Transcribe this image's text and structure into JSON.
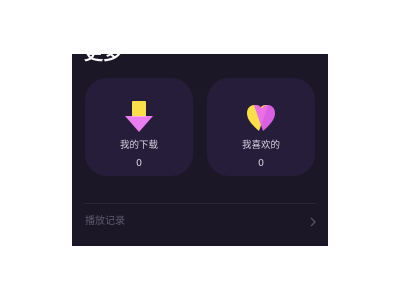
{
  "section": {
    "title": "更多"
  },
  "cards": [
    {
      "label": "我的下载",
      "count": "0",
      "icon": "download-arrow-icon"
    },
    {
      "label": "我喜欢的",
      "count": "0",
      "icon": "heart-icon"
    }
  ],
  "history": {
    "label": "播放记录",
    "icon": "chevron-right-icon"
  },
  "colors": {
    "panel_bg": "#1c1726",
    "card_bg": "#261d3a",
    "text": "#d6d2e0",
    "muted": "#5f5970",
    "yellow": "#f9e04b",
    "pink": "#e866f0"
  }
}
